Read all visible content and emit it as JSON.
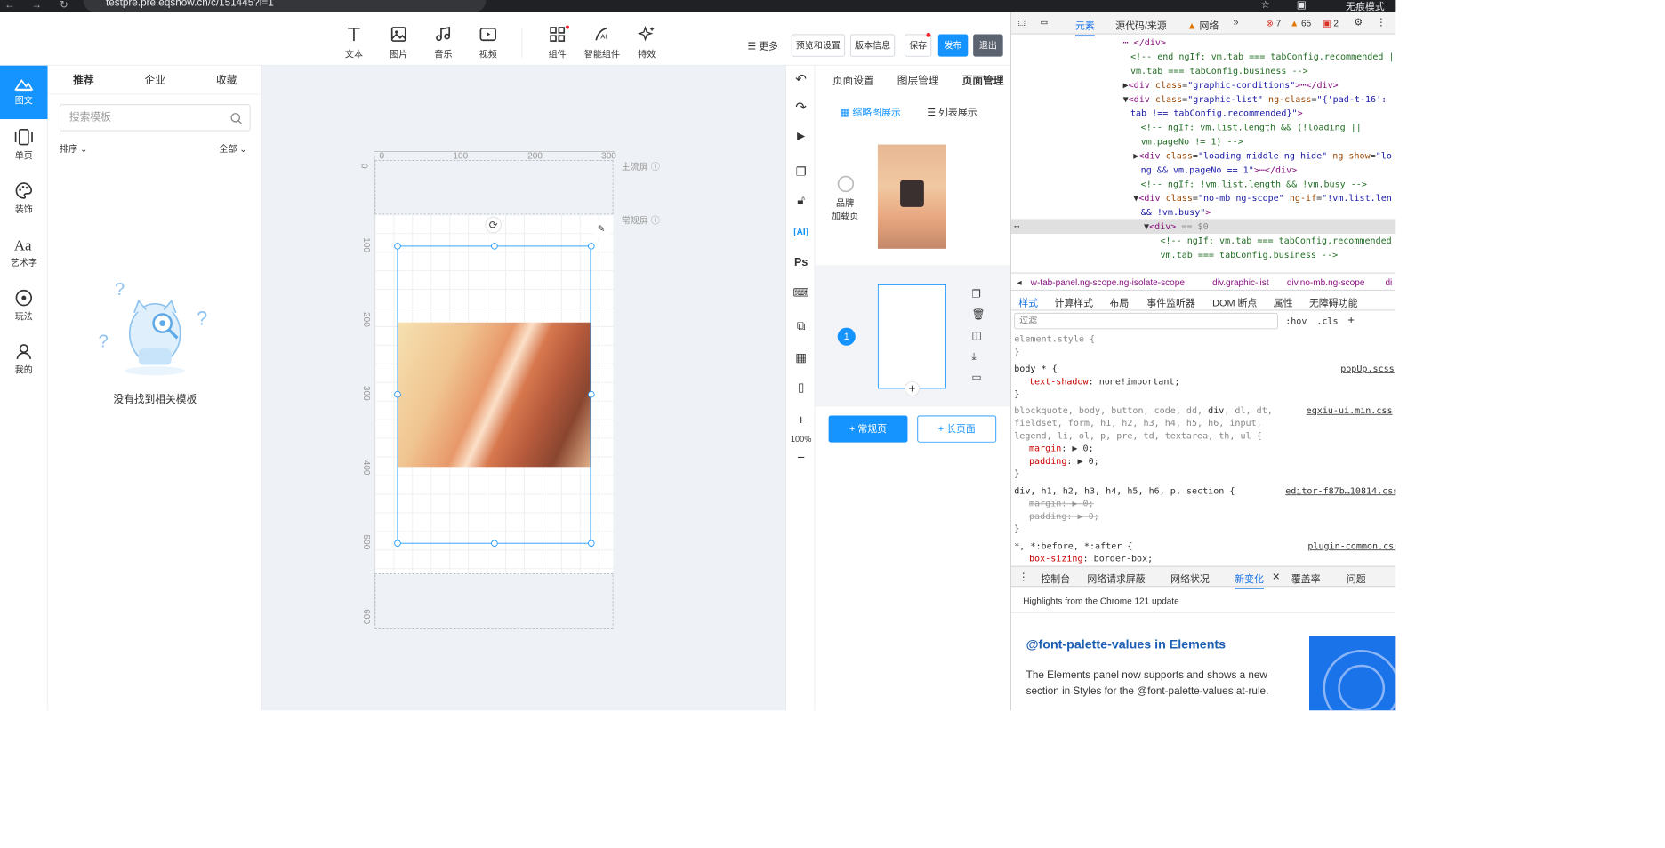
{
  "browser": {
    "url": "testpre.pre.eqshow.cn/c/151445?i=1",
    "mode_label": "无痕模式"
  },
  "toolbar": {
    "tools": [
      {
        "label": "文本",
        "icon": "text-icon"
      },
      {
        "label": "图片",
        "icon": "image-icon"
      },
      {
        "label": "音乐",
        "icon": "music-icon"
      },
      {
        "label": "视频",
        "icon": "video-icon"
      },
      {
        "label": "组件",
        "icon": "component-icon"
      },
      {
        "label": "智能组件",
        "icon": "ai-component-icon"
      },
      {
        "label": "特效",
        "icon": "effects-icon"
      }
    ],
    "more_label": "更多",
    "preview_label": "预览和设置",
    "version_label": "版本信息",
    "save_label": "保存",
    "publish_label": "发布",
    "exit_label": "退出"
  },
  "leftnav": {
    "items": [
      {
        "label": "图文",
        "icon": "image-text-icon"
      },
      {
        "label": "单页",
        "icon": "single-page-icon"
      },
      {
        "label": "装饰",
        "icon": "palette-icon"
      },
      {
        "label": "艺术字",
        "icon": "art-text-icon"
      },
      {
        "label": "玩法",
        "icon": "gameplay-icon"
      },
      {
        "label": "我的",
        "icon": "user-icon"
      }
    ]
  },
  "templates": {
    "tabs": [
      "推荐",
      "企业",
      "收藏"
    ],
    "search_placeholder": "搜索模板",
    "sort_label": "排序",
    "filter_label": "全部",
    "empty_text": "没有找到相关模板"
  },
  "canvas": {
    "ruler_top": [
      "0",
      "100",
      "200",
      "300"
    ],
    "ruler_left": [
      "0",
      "100",
      "200",
      "300",
      "400",
      "500",
      "600"
    ],
    "first_screen_label": "主流屏",
    "normal_screen_label": "常规屏"
  },
  "righttool": {
    "zoom": "100%"
  },
  "pagepanel": {
    "tabs": [
      "页面设置",
      "图层管理",
      "页面管理"
    ],
    "thumb_view": "缩略图展示",
    "list_view": "列表展示",
    "brand_label_1": "品牌",
    "brand_label_2": "加载页",
    "page_number": "1",
    "add_normal": "+ 常规页",
    "add_long": "+ 长页面"
  },
  "devtools": {
    "tabs": [
      "元素",
      "源代码/来源",
      "网络"
    ],
    "errors": "7",
    "warnings": "65",
    "issues": "2",
    "breadcrumb": [
      "w-tab-panel.ng-scope.ng-isolate-scope",
      "div.graphic-list",
      "div.no-mb.ng-scope",
      "di"
    ],
    "style_tabs": [
      "样式",
      "计算样式",
      "布局",
      "事件监听器",
      "DOM 断点",
      "属性",
      "无障碍功能"
    ],
    "filter_placeholder": "过滤",
    "hov": ":hov",
    ".cls": ".cls",
    "drawer_tabs": [
      "控制台",
      "网络请求屏蔽",
      "网络状况",
      "新变化",
      "覆盖率",
      "问题"
    ],
    "highlights": "Highlights from the Chrome 121 update",
    "whatsnew_title": "@font-palette-values in Elements",
    "whatsnew_body": "The Elements panel now supports and shows a new section in Styles for the @font-palette-values at-rule.",
    "files": [
      "popUp.scss",
      "eqxiu-ui.min.css",
      "editor-f87b…10814.css",
      "plugin-common.css"
    ]
  },
  "colors": {
    "accent": "#1593ff",
    "danger": "#f5222d"
  }
}
